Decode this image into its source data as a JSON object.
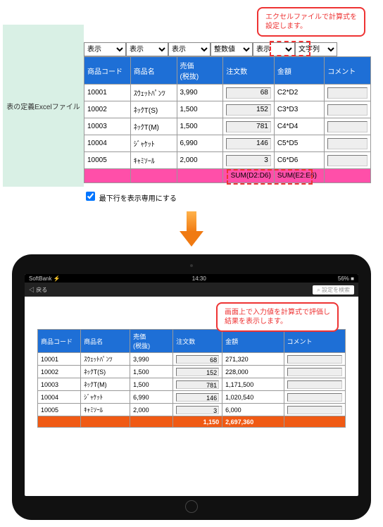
{
  "side_label": "表の定義Excelファイル",
  "callout1_line1": "エクセルファイルで計算式を",
  "callout1_line2": "設定します。",
  "dropdowns": [
    "表示",
    "表示",
    "表示",
    "整数値",
    "表示",
    "文字列"
  ],
  "headers": [
    "商品コード",
    "商品名",
    "売価\n(税抜)",
    "注文数",
    "金額",
    "コメント"
  ],
  "rows": [
    {
      "code": "10001",
      "name": "ｽｳｪｯﾄﾊﾟﾝﾂ",
      "price": "3,990",
      "qty": "68",
      "amount": "C2*D2"
    },
    {
      "code": "10002",
      "name": "ﾈｯｸT(S)",
      "price": "1,500",
      "qty": "152",
      "amount": "C3*D3"
    },
    {
      "code": "10003",
      "name": "ﾈｯｸT(M)",
      "price": "1,500",
      "qty": "781",
      "amount": "C4*D4"
    },
    {
      "code": "10004",
      "name": "ｼﾞｬｹｯﾄ",
      "price": "6,990",
      "qty": "146",
      "amount": "C5*D5"
    },
    {
      "code": "10005",
      "name": "ｷｬﾐｿｰﾙ",
      "price": "2,000",
      "qty": "3",
      "amount": "C6*D6"
    }
  ],
  "sum_qty": "SUM(D2:D6)",
  "sum_amt": "SUM(E2:E6)",
  "checkbox_label": "最下行を表示専用にする",
  "statusbar_left": "SoftBank ⚡",
  "statusbar_time": "14:30",
  "statusbar_right": "56% ■",
  "toolbar_back": "◁ 戻る",
  "toolbar_search": "⌕ 設定を検索",
  "callout2_line1": "画面上で入力値を計算式で評価し",
  "callout2_line2": "結果を表示します。",
  "result_headers": [
    "商品コード",
    "商品名",
    "売価\n(税抜)",
    "注文数",
    "金額",
    "コメント"
  ],
  "result_rows": [
    {
      "code": "10001",
      "name": "ｽｳｪｯﾄﾊﾟﾝﾂ",
      "price": "3,990",
      "qty": "68",
      "amount": "271,320"
    },
    {
      "code": "10002",
      "name": "ﾈｯｸT(S)",
      "price": "1,500",
      "qty": "152",
      "amount": "228,000"
    },
    {
      "code": "10003",
      "name": "ﾈｯｸT(M)",
      "price": "1,500",
      "qty": "781",
      "amount": "1,171,500"
    },
    {
      "code": "10004",
      "name": "ｼﾞｬｹｯﾄ",
      "price": "6,990",
      "qty": "146",
      "amount": "1,020,540"
    },
    {
      "code": "10005",
      "name": "ｷｬﾐｿｰﾙ",
      "price": "2,000",
      "qty": "3",
      "amount": "6,000"
    }
  ],
  "total_qty": "1,150",
  "total_amt": "2,697,360"
}
